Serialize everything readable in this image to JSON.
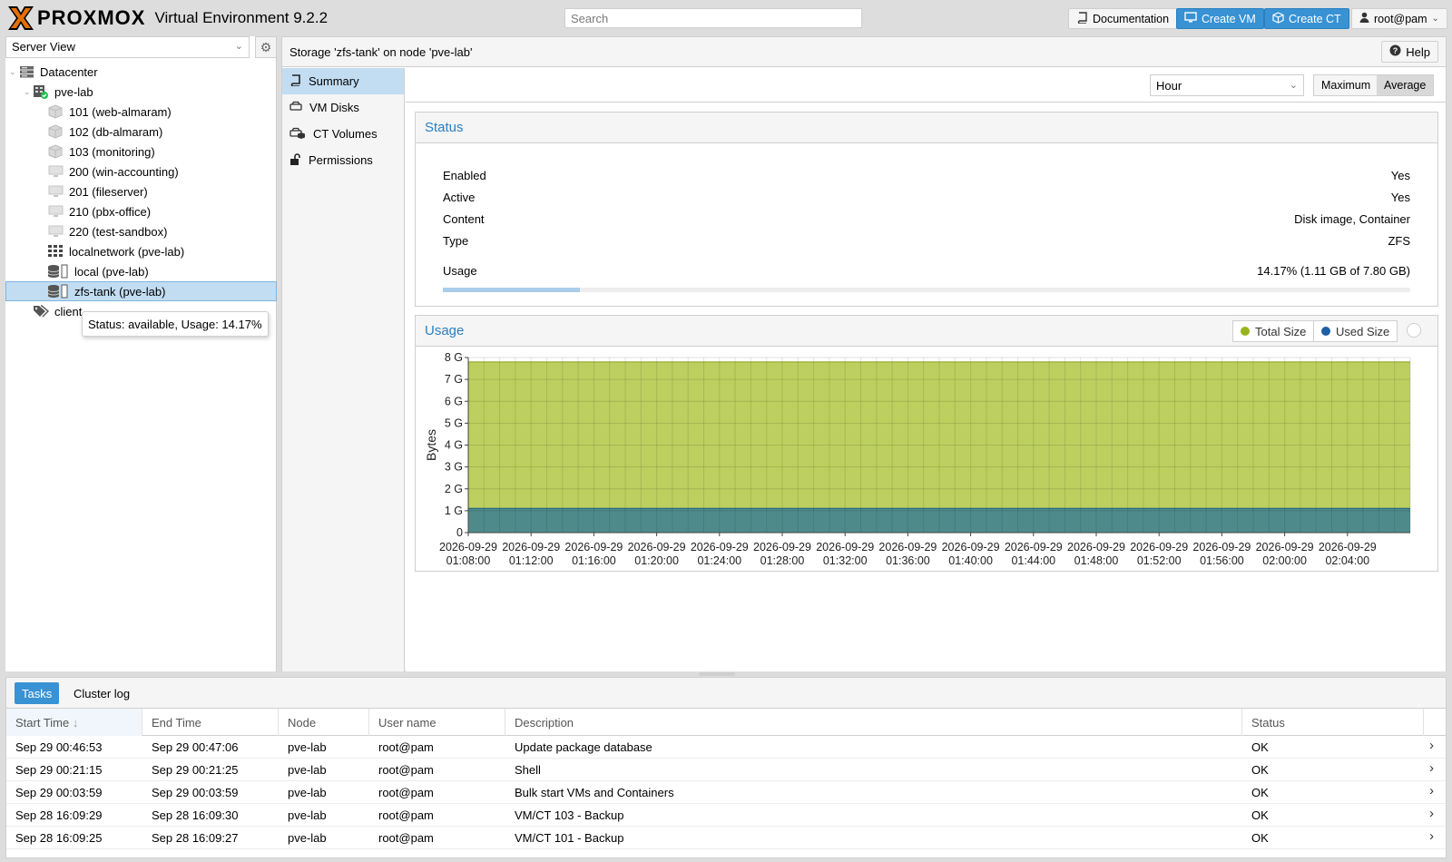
{
  "header": {
    "brand": "PROXMOX",
    "version": "Virtual Environment 9.2.2",
    "search_placeholder": "Search",
    "buttons": {
      "documentation": "Documentation",
      "create_vm": "Create VM",
      "create_ct": "Create CT",
      "user": "root@pam"
    }
  },
  "sidebar": {
    "view": "Server View",
    "tree": [
      {
        "label": "Datacenter",
        "icon": "datacenter-icon"
      },
      {
        "label": "pve-lab",
        "icon": "node-online-icon"
      },
      {
        "label": "101 (web-almaram)",
        "icon": "container-icon"
      },
      {
        "label": "102 (db-almaram)",
        "icon": "container-icon"
      },
      {
        "label": "103 (monitoring)",
        "icon": "container-icon"
      },
      {
        "label": "200 (win-accounting)",
        "icon": "vm-icon"
      },
      {
        "label": "201 (fileserver)",
        "icon": "vm-icon"
      },
      {
        "label": "210 (pbx-office)",
        "icon": "vm-icon"
      },
      {
        "label": "220 (test-sandbox)",
        "icon": "vm-icon"
      },
      {
        "label": "localnetwork (pve-lab)",
        "icon": "network-icon"
      },
      {
        "label": "local (pve-lab)",
        "icon": "storage-icon"
      },
      {
        "label": "zfs-tank (pve-lab)",
        "icon": "storage-icon"
      },
      {
        "label": "client",
        "icon": "tags-icon"
      }
    ],
    "tooltip": "Status: available, Usage: 14.17%"
  },
  "content": {
    "title": "Storage 'zfs-tank' on node 'pve-lab'",
    "help": "Help",
    "nav": [
      "Summary",
      "VM Disks",
      "CT Volumes",
      "Permissions"
    ],
    "timeframe": "Hour",
    "cf_buttons": [
      "Maximum",
      "Average"
    ],
    "status": {
      "title": "Status",
      "rows": [
        {
          "key": "Enabled",
          "value": "Yes"
        },
        {
          "key": "Active",
          "value": "Yes"
        },
        {
          "key": "Content",
          "value": "Disk image, Container"
        },
        {
          "key": "Type",
          "value": "ZFS"
        }
      ],
      "usage_label": "Usage",
      "usage_value": "14.17% (1.11 GB of 7.80 GB)",
      "usage_fraction": 0.1417
    },
    "usage_panel": {
      "title": "Usage",
      "legend": [
        "Total Size",
        "Used Size"
      ]
    }
  },
  "chart_data": {
    "type": "area",
    "title": "Usage",
    "ylabel": "Bytes",
    "ylim": [
      0,
      8
    ],
    "yticks": [
      "0",
      "1 G",
      "2 G",
      "3 G",
      "4 G",
      "5 G",
      "6 G",
      "7 G",
      "8 G"
    ],
    "x": [
      "2026-09-29 01:08:00",
      "2026-09-29 01:12:00",
      "2026-09-29 01:16:00",
      "2026-09-29 01:20:00",
      "2026-09-29 01:24:00",
      "2026-09-29 01:28:00",
      "2026-09-29 01:32:00",
      "2026-09-29 01:36:00",
      "2026-09-29 01:40:00",
      "2026-09-29 01:44:00",
      "2026-09-29 01:48:00",
      "2026-09-29 01:52:00",
      "2026-09-29 01:56:00",
      "2026-09-29 02:00:00",
      "2026-09-29 02:04:00"
    ],
    "series": [
      {
        "name": "Total Size",
        "color": "#bccf5f",
        "value_gb": 7.8
      },
      {
        "name": "Used Size",
        "color": "#4f8a8b",
        "value_gb": 1.11
      }
    ],
    "grid": true,
    "legend": "top-right"
  },
  "tasks": {
    "tabs": [
      "Tasks",
      "Cluster log"
    ],
    "columns": [
      "Start Time",
      "End Time",
      "Node",
      "User name",
      "Description",
      "Status"
    ],
    "rows": [
      [
        "Sep 29 00:46:53",
        "Sep 29 00:47:06",
        "pve-lab",
        "root@pam",
        "Update package database",
        "OK"
      ],
      [
        "Sep 29 00:21:15",
        "Sep 29 00:21:25",
        "pve-lab",
        "root@pam",
        "Shell",
        "OK"
      ],
      [
        "Sep 29 00:03:59",
        "Sep 29 00:03:59",
        "pve-lab",
        "root@pam",
        "Bulk start VMs and Containers",
        "OK"
      ],
      [
        "Sep 28 16:09:29",
        "Sep 28 16:09:30",
        "pve-lab",
        "root@pam",
        "VM/CT 103 - Backup",
        "OK"
      ],
      [
        "Sep 28 16:09:25",
        "Sep 28 16:09:27",
        "pve-lab",
        "root@pam",
        "VM/CT 101 - Backup",
        "OK"
      ]
    ]
  },
  "colors": {
    "accent": "#3892d4",
    "selected": "#c2ddf2",
    "panel_title": "#2b7fc1",
    "logo_orange": "#e57000"
  }
}
